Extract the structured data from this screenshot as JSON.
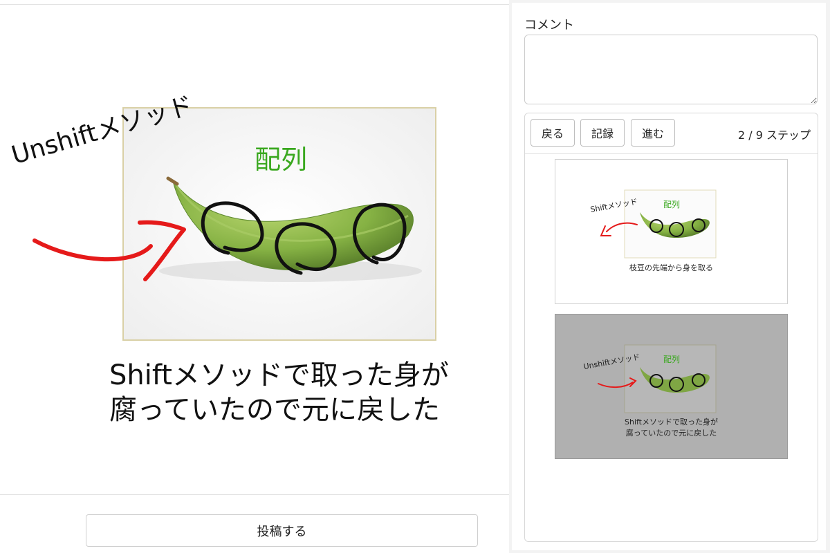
{
  "canvas": {
    "title": "配列",
    "annotation": "Unshiftメソッド",
    "caption_line1": "Shiftメソッドで取った身が",
    "caption_line2": "腐っていたので元に戻した"
  },
  "post_button_label": "投稿する",
  "comment": {
    "label": "コメント",
    "value": ""
  },
  "toolbar": {
    "back": "戻る",
    "record": "記録",
    "forward": "進む",
    "step_counter": "2 / 9 ステップ"
  },
  "steps": [
    {
      "annotation": "Shiftメソッド",
      "title": "配列",
      "caption": "枝豆の先端から身を取る"
    },
    {
      "annotation": "Unshiftメソッド",
      "title": "配列",
      "caption_line1": "Shiftメソッドで取った身が",
      "caption_line2": "腐っていたので元に戻した"
    }
  ],
  "colors": {
    "title_green": "#3aa81f",
    "arrow_red": "#e51a1a",
    "pod_green": "#8cba4a",
    "selected_bg": "#b0b0b0"
  },
  "icons": [
    "edamame-pod-image",
    "arrow-icon",
    "resize-grip-icon"
  ]
}
